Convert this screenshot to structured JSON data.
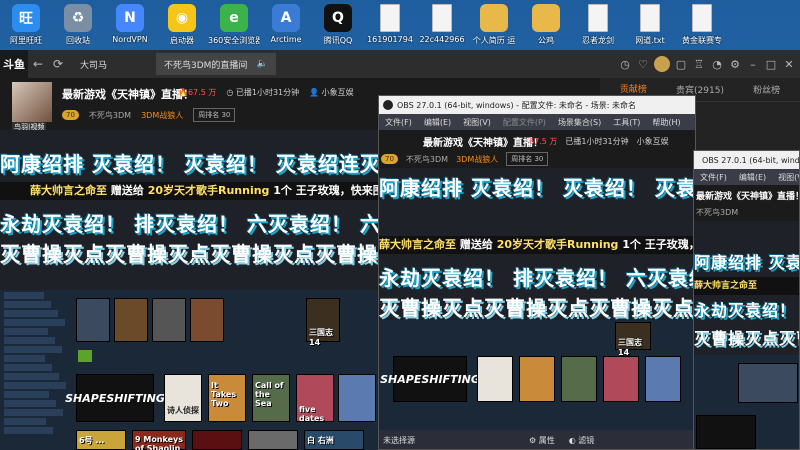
{
  "desktop_icons": [
    {
      "label": "阿里旺旺",
      "icon": "aliwangwang-icon",
      "color": "#2d8cf0",
      "glyph": "旺"
    },
    {
      "label": "回收站",
      "icon": "recycle-bin-icon",
      "color": "#7a8ea6",
      "glyph": "♻"
    },
    {
      "label": "NordVPN",
      "icon": "nordvpn-icon",
      "color": "#4687ff",
      "glyph": "N"
    },
    {
      "label": "启动器",
      "icon": "launcher-icon",
      "color": "#f5c518",
      "glyph": "◉"
    },
    {
      "label": "360安全浏览器",
      "icon": "360-browser-icon",
      "color": "#3cb34a",
      "glyph": "e"
    },
    {
      "label": "Arctime",
      "icon": "arctime-icon",
      "color": "#3a7bd5",
      "glyph": "A"
    },
    {
      "label": "腾讯QQ",
      "icon": "qq-icon",
      "color": "#111111",
      "glyph": "Q"
    },
    {
      "label": "161901794",
      "icon": "file-icon",
      "color": "#f4f4f4",
      "glyph": ""
    },
    {
      "label": "22c442966",
      "icon": "file-icon",
      "color": "#f4f4f4",
      "glyph": ""
    },
    {
      "label": "个人简历 运",
      "icon": "folder-icon",
      "color": "#e8b84a",
      "glyph": ""
    },
    {
      "label": "公鸡",
      "icon": "folder-icon",
      "color": "#e8b84a",
      "glyph": ""
    },
    {
      "label": "忍者龙剑",
      "icon": "file-icon",
      "color": "#f4f4f4",
      "glyph": ""
    },
    {
      "label": "网道.txt",
      "icon": "text-file-icon",
      "color": "#f4f4f4",
      "glyph": ""
    },
    {
      "label": "黄金联赛专",
      "icon": "file-icon",
      "color": "#f4f4f4",
      "glyph": ""
    }
  ],
  "browser": {
    "logo": "斗鱼",
    "tabs": [
      {
        "label": "大司马"
      },
      {
        "label": "不死鸟3DM的直播间"
      }
    ],
    "right_tabs": [
      "贡献榜",
      "贵宾(2915)",
      "粉丝榜"
    ],
    "room": {
      "title": "最新游戏《天神镇》直播！",
      "hot": "67.5 万",
      "duration": "已播1小时31分钟",
      "group": "小象互娱",
      "host": "不死鸟3DM",
      "fan_badge": "3DM战狼人",
      "level_badge": "70",
      "rank": "周排名 30",
      "avatar_tag": "鸟羽|视频"
    }
  },
  "stream": {
    "marquee_1": "阿康绍排 灭袁绍！ 灭袁绍！ 灭袁绍连灭袁绍连 灭袁绍！",
    "gift": {
      "who": "薛大帅言之命至",
      "verb": "赠送给",
      "to": "20岁天才歌手Running",
      "item": "1个 王子玫瑰，快来围观"
    },
    "marquee_2": "永劫灭袁绍！ 排灭袁绍！ 六灭袁绍！ 六灭袁绍！",
    "marquee_3": "灭曹操灭点灭曹操灭点灭曹操灭点灭曹操",
    "games": [
      {
        "title": "SHAPESHIFTING",
        "name": "shapeshifting-tile"
      },
      {
        "title": "诗人侦探",
        "name": "poet-detective-tile"
      },
      {
        "title": "It Takes Two",
        "name": "it-takes-two-tile"
      },
      {
        "title": "Call of the Sea",
        "name": "call-of-the-sea-tile"
      },
      {
        "title": "five dates",
        "name": "five-dates-tile"
      },
      {
        "title": "三国志14",
        "name": "sanguozhi-tile"
      },
      {
        "title": "6号 ...",
        "name": "game-6-tile"
      },
      {
        "title": "9 Monkeys of Shaolin",
        "name": "nine-monkeys-tile"
      },
      {
        "title": "白 右洲",
        "name": "bai-youzhou-tile"
      }
    ]
  },
  "obs_1": {
    "title": "OBS 27.0.1 (64-bit, windows) - 配置文件: 未命名 - 场景: 未命名",
    "menu": [
      "文件(F)",
      "编辑(E)",
      "视图(V)",
      "配置文件(P)",
      "场景集合(S)",
      "工具(T)",
      "帮助(H)"
    ],
    "status_left": "未选择源",
    "status_props": "属性",
    "status_filters": "滤镜"
  },
  "obs_2": {
    "title": "OBS 27.0.1 (64-bit, windows)",
    "menu": [
      "文件(F)",
      "编辑(E)",
      "视图(V)"
    ]
  }
}
